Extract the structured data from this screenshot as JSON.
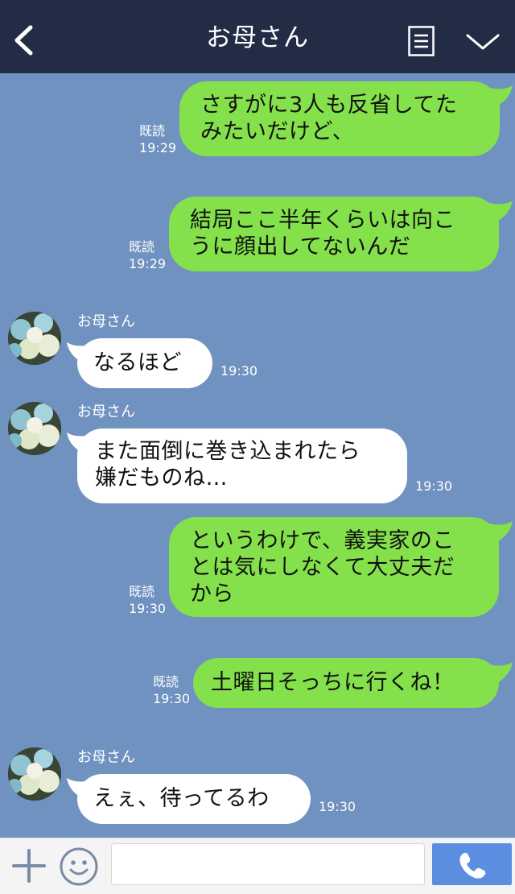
{
  "header": {
    "title": "お母さん"
  },
  "messages": [
    {
      "from": "me",
      "lines": [
        "さすがに3人も反省してた",
        "みたいだけど、"
      ],
      "read": "既読",
      "time": "19:29"
    },
    {
      "from": "me",
      "lines": [
        "結局ここ半年くらいは向こ",
        "うに顔出してないんだ"
      ],
      "read": "既読",
      "time": "19:29"
    },
    {
      "from": "them",
      "sender": "お母さん",
      "lines": [
        "なるほど"
      ],
      "time": "19:30"
    },
    {
      "from": "them",
      "sender": "お母さん",
      "lines": [
        "また面倒に巻き込まれたら",
        "嫌だものね…"
      ],
      "time": "19:30"
    },
    {
      "from": "me",
      "lines": [
        "というわけで、義実家のこ",
        "とは気にしなくて大丈夫だ",
        "から"
      ],
      "read": "既読",
      "time": "19:30"
    },
    {
      "from": "me",
      "lines": [
        "土曜日そっちに行くね！"
      ],
      "read": "既読",
      "time": "19:30"
    },
    {
      "from": "them",
      "sender": "お母さん",
      "lines": [
        "えぇ、待ってるわ"
      ],
      "time": "19:30"
    }
  ],
  "icons": {
    "back": "chevron-left-icon",
    "menu": "menu-icon",
    "collapse": "chevron-down-icon",
    "plus": "plus-icon",
    "emoji": "emoji-icon",
    "call": "phone-icon"
  },
  "colors": {
    "header_bg": "#222d45",
    "chat_bg": "#7092c0",
    "my_bubble": "#84e14b",
    "their_bubble": "#ffffff",
    "call_button": "#5b8ee0"
  },
  "composer": {
    "value": "",
    "placeholder": ""
  }
}
